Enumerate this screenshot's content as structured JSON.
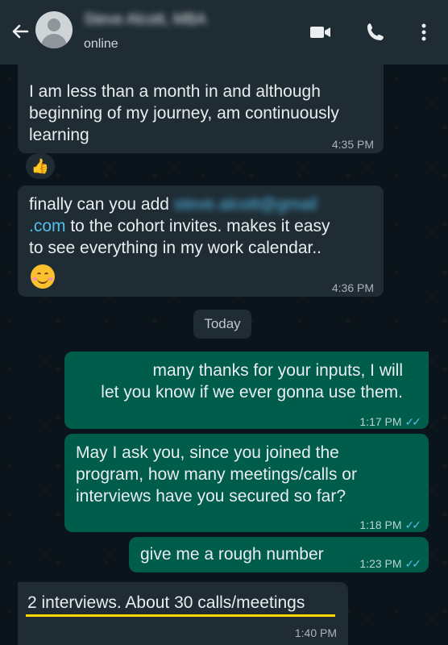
{
  "header": {
    "contact_name": "Steve Alcott, MBA",
    "status": "online"
  },
  "messages": [
    {
      "direction": "in",
      "lines": [
        "I am less than a month in and although",
        "beginning of my journey, am continuously",
        "learning"
      ],
      "time": "4:35 PM",
      "reaction": "👍"
    },
    {
      "direction": "in",
      "line1_prefix": "finally can you add ",
      "line1_hidden": "steve.alcott@gmail",
      "line2_link": ".com",
      "line2_rest": " to the cohort invites. makes it easy",
      "line3": "to see everything in my work calendar..",
      "time": "4:36 PM"
    },
    {
      "direction": "out",
      "lines": [
        "many thanks for your inputs, I will",
        "let you know if we ever gonna use them."
      ],
      "time": "1:17 PM"
    },
    {
      "direction": "out",
      "lines": [
        "May I ask you, since you joined the",
        "program, how many meetings/calls or",
        "interviews have you secured so far?"
      ],
      "time": "1:18 PM"
    },
    {
      "direction": "out",
      "lines": [
        "give me a rough number"
      ],
      "time": "1:23 PM"
    },
    {
      "direction": "in",
      "lines": [
        "2 interviews. About 30 calls/meetings"
      ],
      "time": "1:40 PM"
    }
  ],
  "day_separator": "Today",
  "colors": {
    "incoming_bubble": "#1f2c34",
    "outgoing_bubble": "#005c4b",
    "read_ticks": "#53bdeb",
    "highlight_underline": "#ffd600"
  }
}
